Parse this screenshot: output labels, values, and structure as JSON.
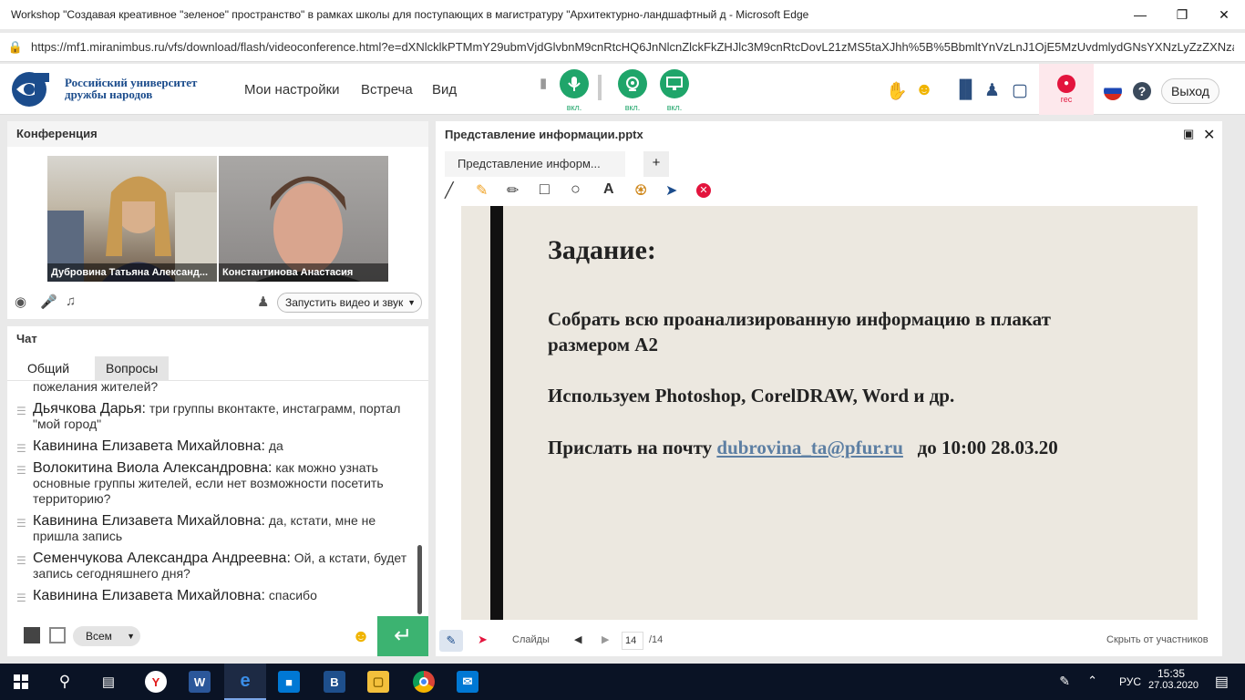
{
  "window": {
    "title": "Workshop \"Создавая креативное \"зеленое\" пространство\" в рамках школы для поступающих в магистратуру \"Архитектурно-ландшафтный д - Microsoft Edge",
    "url": "https://mf1.miranimbus.ru/vfs/download/flash/videoconference.html?e=dXNlcklkPTMmY29ubmVjdGlvbnM9cnRtcHQ6JnNlcnZlckFkZHJlc3M9cnRtcDovL21zMS5taXJhh%5B%5BbmltYnVzLnJ1OjE5MzUvdmlydGNsYXNzLyZzZXNzaW9uS"
  },
  "header": {
    "logo_text_1": "Российский университет",
    "logo_text_2": "дружбы народов",
    "menu": [
      "Мои настройки",
      "Встреча",
      "Вид"
    ],
    "mic_label": "вкл.",
    "cam_label": "вкл.",
    "screen_label": "вкл.",
    "rec_label": "rec",
    "exit_label": "Выход"
  },
  "conference": {
    "title": "Конференция",
    "participants": [
      {
        "name": "Дубровина Татьяна Александ..."
      },
      {
        "name": "Константинова Анастасия"
      }
    ],
    "start_av_label": "Запустить видео и звук"
  },
  "chat": {
    "title": "Чат",
    "tabs": [
      "Общий",
      "Вопросы"
    ],
    "messages": [
      {
        "author": "",
        "text": "пожелания жителей?"
      },
      {
        "author": "Дьячкова Дарья:",
        "text": " три группы вконтакте, инстаграмм, портал \"мой город\""
      },
      {
        "author": "Кавинина  Елизавета  Михайловна:",
        "text": " да"
      },
      {
        "author": "Волокитина Виола Александровна:",
        "text": " как можно узнать основные группы жителей, если нет возможности посетить территорию?"
      },
      {
        "author": "Кавинина  Елизавета  Михайловна:",
        "text": " да, кстати, мне не пришла запись"
      },
      {
        "author": "Семенчукова Александра  Андреевна:",
        "text": " Ой, а кстати, будет запись сегодняшнего дня?"
      },
      {
        "author": "Кавинина  Елизавета  Михайловна:",
        "text": " спасибо"
      }
    ],
    "recipient": "Всем"
  },
  "presentation": {
    "title": "Представление информации.pptx",
    "tab_label": "Представление информ...",
    "add_tab": "+",
    "slide": {
      "heading": "Задание:",
      "line1": "Собрать всю проанализированную  информацию в плакат",
      "line2": "размером А2",
      "line3": "Используем  Photoshop, CorelDRAW,  Word  и др.",
      "line4_prefix": "Прислать на почту ",
      "email": "dubrovina_ta@pfur.ru",
      "line4_suffix": "   до 10:00 28.03.20"
    },
    "slides_label": "Слайды",
    "current_page": "14",
    "total_pages": "/14",
    "hide_label": "Скрыть от участников"
  },
  "taskbar": {
    "language": "РУС",
    "time": "15:35",
    "date": "27.03.2020"
  }
}
